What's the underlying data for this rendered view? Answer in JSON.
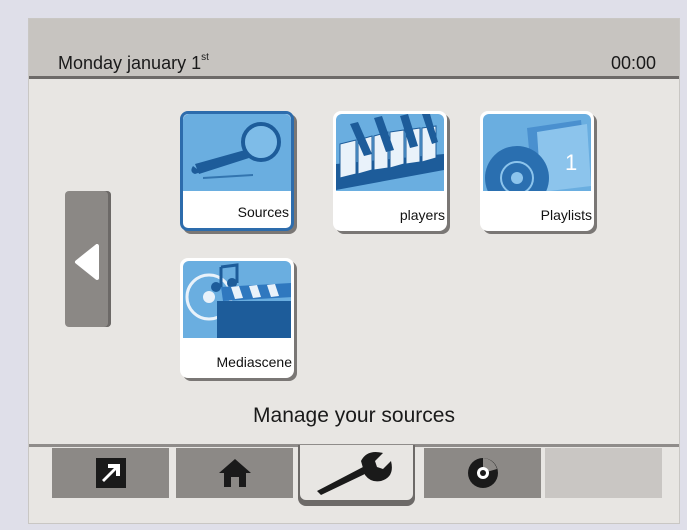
{
  "header": {
    "date_main": "Monday january 1",
    "date_sup": "st",
    "time": "00:00"
  },
  "tiles": [
    {
      "label": "Sources",
      "icon": "magnifier-icon",
      "selected": true
    },
    {
      "label": "players",
      "icon": "keyboard-icon",
      "selected": false
    },
    {
      "label": "Playlists",
      "icon": "playlist-discs-icon",
      "selected": false
    },
    {
      "label": "Mediascene",
      "icon": "disc-clapper-icon",
      "selected": false
    }
  ],
  "playlist_number": "1",
  "caption": "Manage your sources",
  "tabs": [
    {
      "icon": "arrow-out-icon",
      "active": false
    },
    {
      "icon": "home-icon",
      "active": false
    },
    {
      "icon": "wrench-icon",
      "active": true
    },
    {
      "icon": "disc-icon",
      "active": false
    },
    {
      "icon": "",
      "active": false
    }
  ],
  "colors": {
    "accent": "#2d6cac",
    "tile_art": "#6aaee0",
    "header_bg": "#c7c4c0"
  }
}
